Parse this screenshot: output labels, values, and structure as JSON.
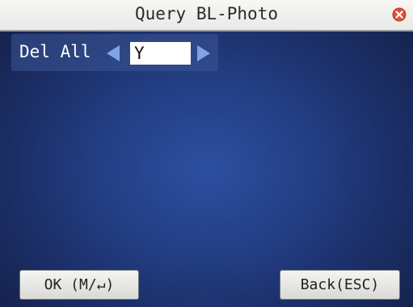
{
  "window": {
    "title": "Query BL-Photo"
  },
  "icons": {
    "close": "close-icon"
  },
  "colors": {
    "title_bar": "#eeeeec",
    "close_icon": "#e0503a",
    "screen_bg": "#233f86",
    "arrow": "#7fa3e6"
  },
  "setting": {
    "label": "Del All",
    "value": "Y"
  },
  "buttons": {
    "ok_label": "OK (M/↵)",
    "back_label": "Back(ESC)"
  }
}
